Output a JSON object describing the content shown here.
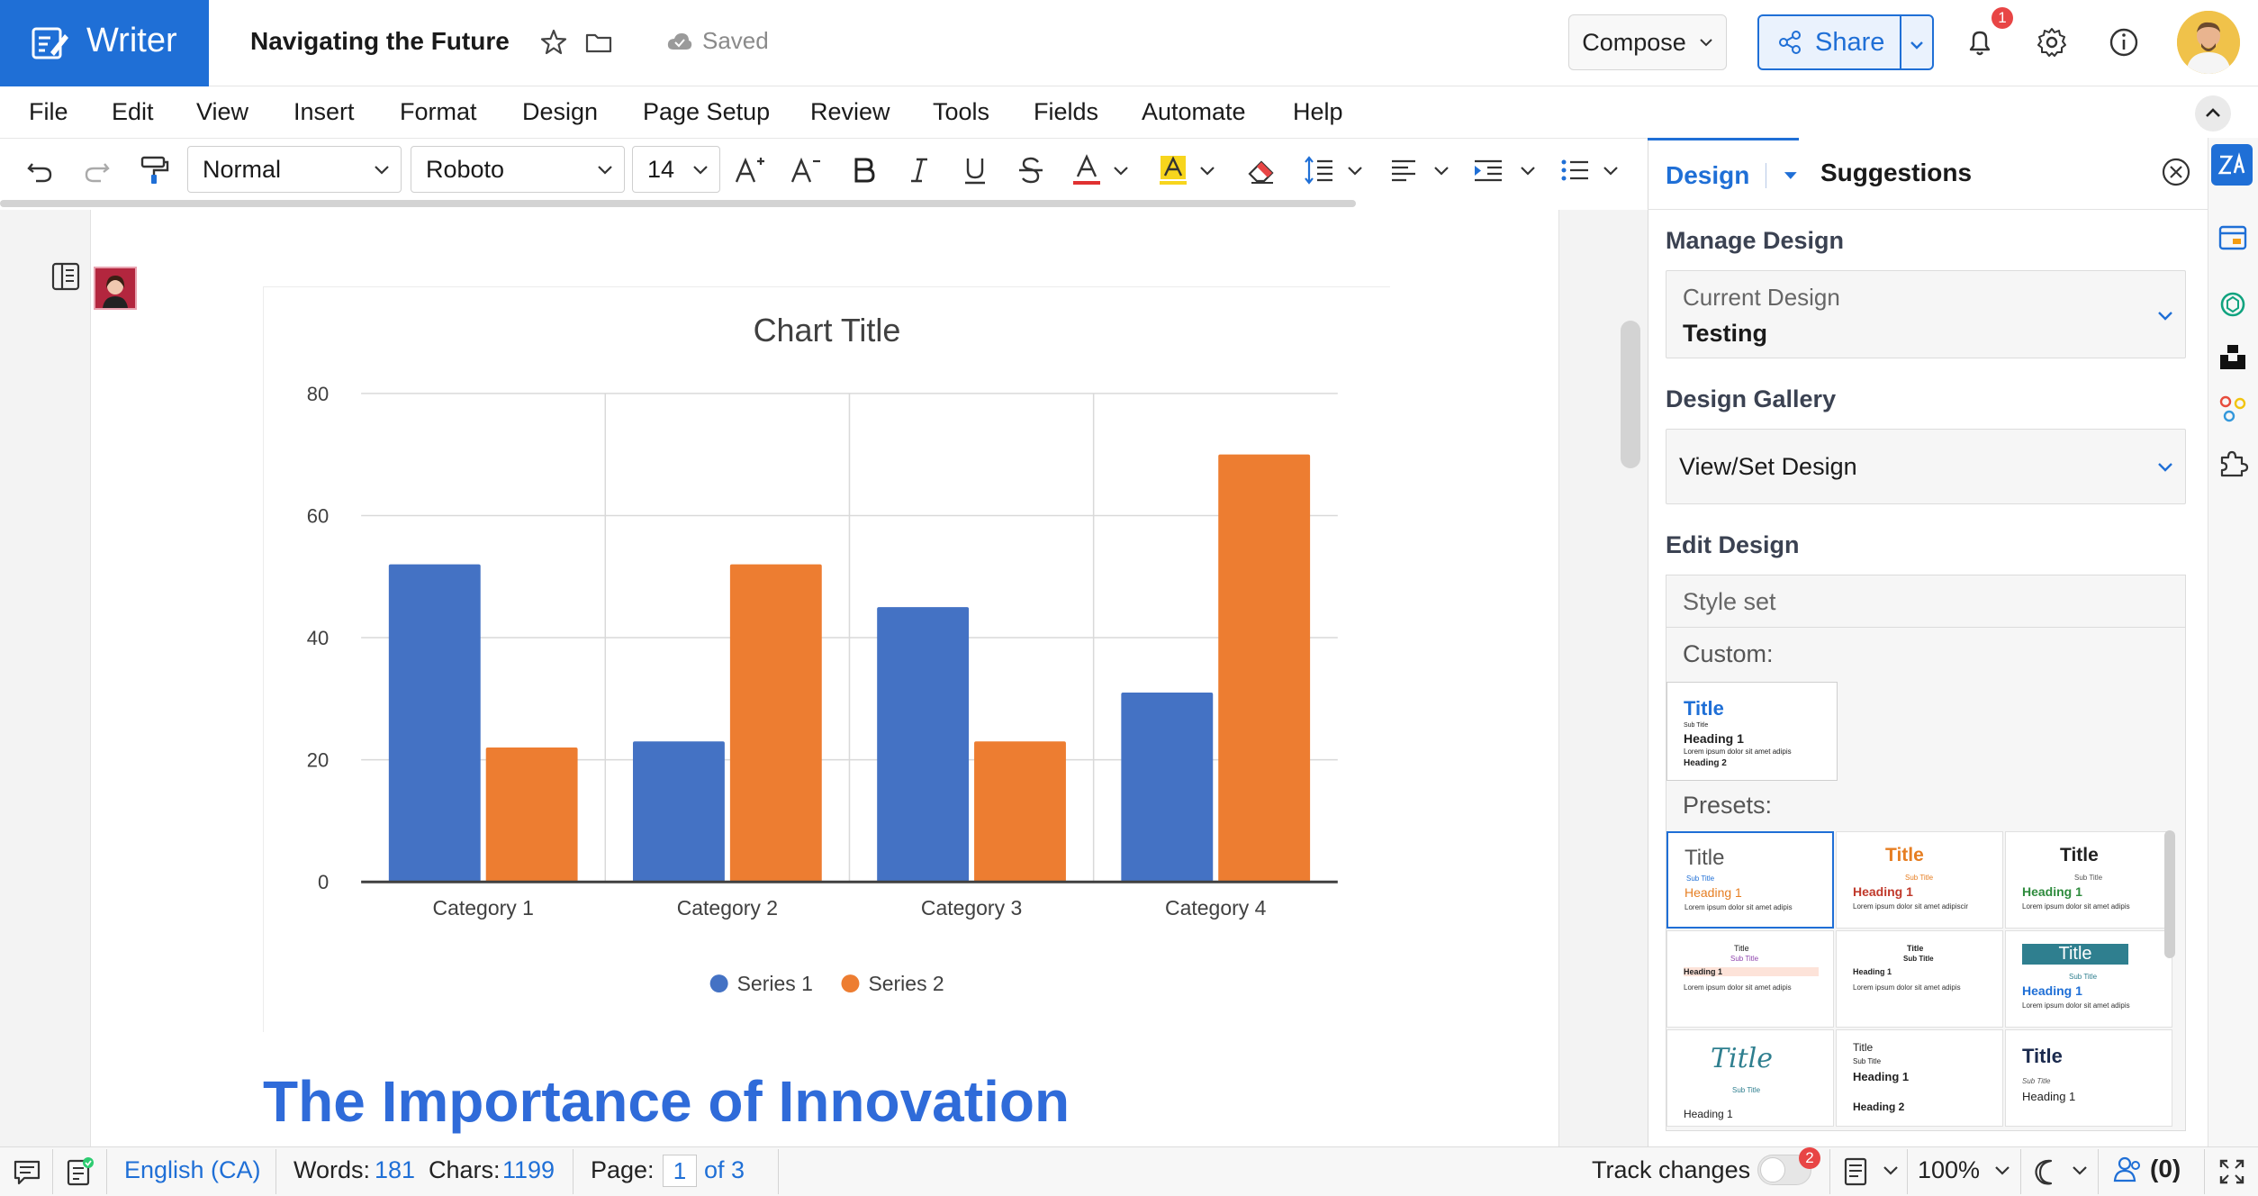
{
  "app": {
    "name": "Writer"
  },
  "document": {
    "title": "Navigating the Future",
    "save_status": "Saved"
  },
  "topbar": {
    "compose_label": "Compose",
    "share_label": "Share",
    "notification_count": "1"
  },
  "menu": {
    "items": [
      "File",
      "Edit",
      "View",
      "Insert",
      "Format",
      "Design",
      "Page Setup",
      "Review",
      "Tools",
      "Fields",
      "Automate",
      "Help"
    ]
  },
  "toolbar": {
    "paragraph_style": "Normal",
    "font_family_value": "Roboto",
    "font_size_value": "14",
    "colors": {
      "font_color": "#e03131",
      "highlight_color": "#f7d51d"
    }
  },
  "chart_data": {
    "type": "bar",
    "title": "Chart Title",
    "categories": [
      "Category 1",
      "Category 2",
      "Category 3",
      "Category 4"
    ],
    "series": [
      {
        "name": "Series 1",
        "values": [
          52,
          23,
          45,
          31
        ],
        "color": "#4472c4"
      },
      {
        "name": "Series 2",
        "values": [
          22,
          52,
          23,
          70
        ],
        "color": "#ed7d31"
      }
    ],
    "ylim": [
      0,
      80
    ],
    "yticks": [
      "0",
      "20",
      "40",
      "60",
      "80"
    ],
    "grid": true,
    "legend": "bottom"
  },
  "content": {
    "heading": "The Importance of Innovation"
  },
  "panel": {
    "tab_design": "Design",
    "tab_suggestions": "Suggestions",
    "manage_design_heading": "Manage Design",
    "current_design_label": "Current Design",
    "current_design_value": "Testing",
    "design_gallery_heading": "Design Gallery",
    "gallery_select_value": "View/Set Design",
    "edit_design_heading": "Edit Design",
    "style_set_label": "Style set",
    "custom_label": "Custom:",
    "presets_label": "Presets:",
    "custom_style": {
      "title": "Title",
      "subtitle": "Sub Title",
      "heading1": "Heading 1",
      "body": "Lorem ipsum dolor sit amet adipis",
      "heading2": "Heading 2"
    },
    "presets": [
      {
        "title": "Title",
        "subtitle": "Sub Title",
        "heading": "Heading 1",
        "body": "Lorem ipsum dolor sit amet adipis"
      },
      {
        "title": "Title",
        "subtitle": "Sub Title",
        "heading": "Heading 1",
        "body": "Lorem ipsum dolor sit amet adipiscir"
      },
      {
        "title": "Title",
        "subtitle": "Sub Title",
        "heading": "Heading 1",
        "body": "Lorem ipsum dolor sit amet adipis"
      },
      {
        "title": "Title",
        "subtitle": "Sub Title",
        "heading": "Heading 1",
        "body": "Lorem ipsum dolor sit amet adipis"
      },
      {
        "title": "Title",
        "subtitle": "Sub Title",
        "heading": "Heading 1",
        "body": "Lorem ipsum dolor sit amet adipis"
      },
      {
        "title": "Title",
        "subtitle": "Sub Title",
        "heading": "Heading 1",
        "body": "Lorem ipsum dolor sit amet adipis"
      },
      {
        "title": "Title",
        "subtitle": "Sub Title",
        "heading": "Heading 1",
        "body": ""
      },
      {
        "title": "Title",
        "subtitle": "Sub Title",
        "heading": "Heading 1",
        "body": "Heading 2"
      },
      {
        "title": "Title",
        "subtitle": "Sub Title",
        "heading": "Heading 1",
        "body": ""
      }
    ]
  },
  "status": {
    "language": "English (CA)",
    "words_label": "Words:",
    "words_value": "181",
    "chars_label": "Chars:",
    "chars_value": "1199",
    "page_label": "Page:",
    "page_current": "1",
    "page_total": "of 3",
    "track_changes_label": "Track changes",
    "track_changes_badge": "2",
    "zoom": "100%",
    "collaborators": "(0)"
  },
  "colors": {
    "brand": "#1f6fd6",
    "heading": "#2f6bd9"
  }
}
